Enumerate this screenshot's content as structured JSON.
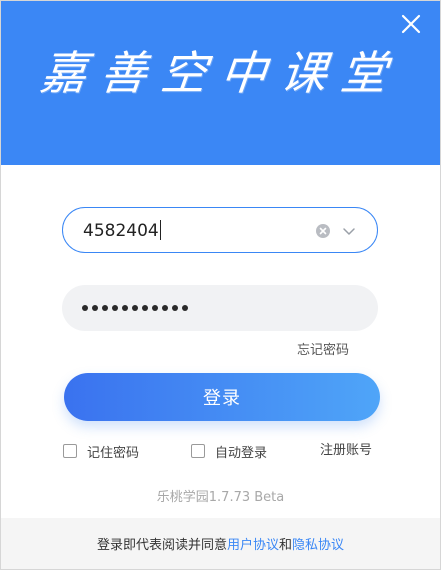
{
  "header": {
    "brand_title": "嘉善空中课堂",
    "background_color": "#3b87f5",
    "close_icon": "close-icon"
  },
  "login_form": {
    "account_value": "4582404",
    "clear_icon": "clear-icon",
    "dropdown_icon": "chevron-down-icon",
    "password_dot_count": 11,
    "forgot_password_label": "忘记密码",
    "login_button_label": "登录"
  },
  "options": {
    "remember_password_label": "记住密码",
    "remember_password_checked": false,
    "auto_login_label": "自动登录",
    "auto_login_checked": false,
    "register_label": "注册账号"
  },
  "version_text": "乐桃学园1.7.73 Beta",
  "footer": {
    "prefix": "登录即代表阅读并同意",
    "user_agreement": "用户协议",
    "and": "和",
    "privacy_policy": "隐私协议",
    "link_color": "#3a87f5"
  }
}
